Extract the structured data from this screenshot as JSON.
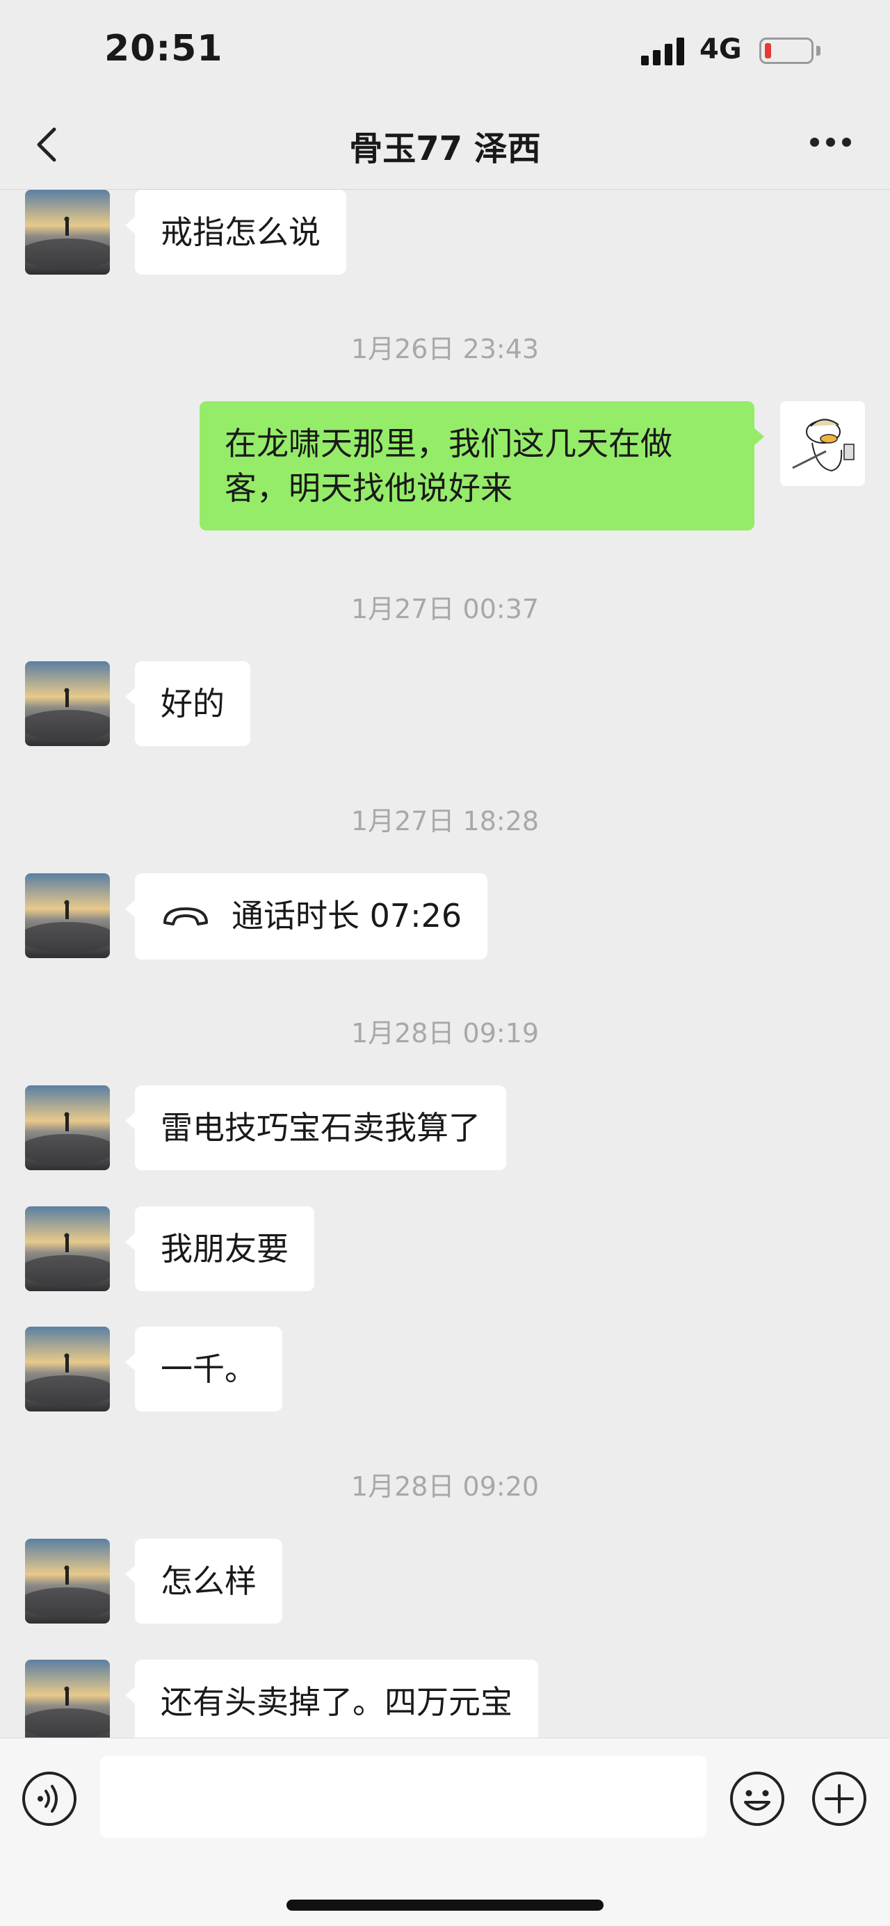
{
  "status_bar": {
    "time": "20:51",
    "network": "4G",
    "battery_color": "#e53935"
  },
  "nav": {
    "title": "骨玉77 泽西",
    "back_icon": "chevron-left-icon",
    "more_icon": "more-dots-icon"
  },
  "colors": {
    "background": "#ededed",
    "received_bubble": "#ffffff",
    "sent_bubble": "#95ec69",
    "timestamp": "#a8a8a8"
  },
  "messages": [
    {
      "type": "text",
      "side": "left",
      "text": "戒指怎么说"
    },
    {
      "type": "timestamp",
      "text": "1月26日 23:43"
    },
    {
      "type": "text",
      "side": "right",
      "line1": "在龙啸天那里，我们这几天在做",
      "line2": "客，明天找他说好来"
    },
    {
      "type": "timestamp",
      "text": "1月27日 00:37"
    },
    {
      "type": "text",
      "side": "left",
      "text": "好的"
    },
    {
      "type": "timestamp",
      "text": "1月27日 18:28"
    },
    {
      "type": "call",
      "side": "left",
      "icon": "phone-hangup-icon",
      "text": "通话时长 07:26"
    },
    {
      "type": "timestamp",
      "text": "1月28日 09:19"
    },
    {
      "type": "text",
      "side": "left",
      "text": "雷电技巧宝石卖我算了"
    },
    {
      "type": "text",
      "side": "left",
      "text": "我朋友要"
    },
    {
      "type": "text",
      "side": "left",
      "text": "一千。"
    },
    {
      "type": "timestamp",
      "text": "1月28日 09:20"
    },
    {
      "type": "text",
      "side": "left",
      "text": "怎么样"
    },
    {
      "type": "text",
      "side": "left",
      "text": "还有头卖掉了。四万元宝"
    }
  ],
  "input_bar": {
    "voice_icon": "voice-icon",
    "emoji_icon": "emoji-icon",
    "plus_icon": "plus-icon",
    "input_value": ""
  }
}
